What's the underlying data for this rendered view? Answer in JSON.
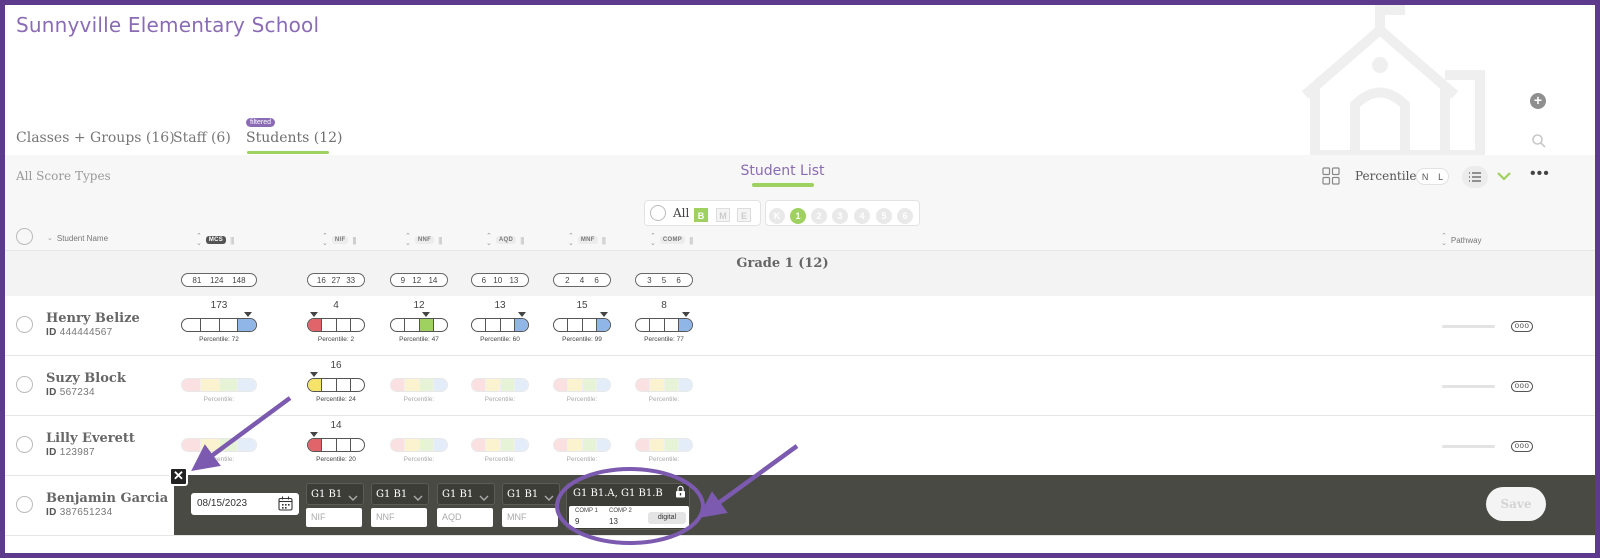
{
  "school": {
    "name": "Sunnyville Elementary School"
  },
  "tabs": [
    {
      "label": "Classes + Groups (16)"
    },
    {
      "label": "Staff (6)"
    },
    {
      "label": "Students (12)",
      "badge": "filtered",
      "active": true
    }
  ],
  "toolbar": {
    "score_types": "All Score Types",
    "list_title": "Student List",
    "percentile_label": "Percentile",
    "toggle_n": "N",
    "toggle_l": "L",
    "more": "•••"
  },
  "filters": {
    "all_label": "All",
    "terms": [
      "B",
      "M",
      "E"
    ],
    "active_term": "B",
    "grades": [
      "K",
      "1",
      "2",
      "3",
      "4",
      "5",
      "6"
    ],
    "active_grade": "1"
  },
  "columns": {
    "student_name": "Student Name",
    "measures": [
      "MCS",
      "NIF",
      "NNF",
      "AQD",
      "MNF",
      "COMP"
    ],
    "pathway": "Pathway"
  },
  "grade_group": {
    "title": "Grade 1 (12)",
    "ranges": [
      [
        "81",
        "124",
        "148"
      ],
      [
        "16",
        "27",
        "33"
      ],
      [
        "9",
        "12",
        "14"
      ],
      [
        "6",
        "10",
        "13"
      ],
      [
        "2",
        "4",
        "6"
      ],
      [
        "3",
        "5",
        "6"
      ]
    ]
  },
  "students": [
    {
      "name": "Henry Belize",
      "id_label": "ID",
      "id": "444444567",
      "scores": [
        {
          "value": "173",
          "percentile": "Percentile: 72",
          "fill_segment": 4,
          "color": "#8fb6e6",
          "level": 0.72
        },
        {
          "value": "4",
          "percentile": "Percentile: 2",
          "fill_segment": 1,
          "color": "#e0646a",
          "level": 0.02
        },
        {
          "value": "12",
          "percentile": "Percentile: 47",
          "fill_segment": 3,
          "color": "#9fd160",
          "level": 0.47
        },
        {
          "value": "13",
          "percentile": "Percentile: 60",
          "fill_segment": 4,
          "color": "#8fb6e6",
          "level": 0.6
        },
        {
          "value": "15",
          "percentile": "Percentile: 99",
          "fill_segment": 4,
          "color": "#8fb6e6",
          "level": 0.99
        },
        {
          "value": "8",
          "percentile": "Percentile: 77",
          "fill_segment": 4,
          "color": "#8fb6e6",
          "level": 0.77
        }
      ]
    },
    {
      "name": "Suzy Block",
      "id_label": "ID",
      "id": "567234",
      "scores": [
        {
          "value": "",
          "percentile": "Percentile:",
          "faded": true
        },
        {
          "value": "16",
          "percentile": "Percentile: 24",
          "fill_segment": 1,
          "color": "#f5e36a",
          "level": 0.24
        },
        {
          "value": "",
          "percentile": "Percentile:",
          "faded": true
        },
        {
          "value": "",
          "percentile": "Percentile:",
          "faded": true
        },
        {
          "value": "",
          "percentile": "Percentile:",
          "faded": true
        },
        {
          "value": "",
          "percentile": "Percentile:",
          "faded": true
        }
      ]
    },
    {
      "name": "Lilly Everett",
      "id_label": "ID",
      "id": "123987",
      "scores": [
        {
          "value": "",
          "percentile": "Percentile:",
          "faded": true
        },
        {
          "value": "14",
          "percentile": "Percentile: 20",
          "fill_segment": 1,
          "color": "#e0646a",
          "level": 0.2
        },
        {
          "value": "",
          "percentile": "Percentile:",
          "faded": true
        },
        {
          "value": "",
          "percentile": "Percentile:",
          "faded": true
        },
        {
          "value": "",
          "percentile": "Percentile:",
          "faded": true
        },
        {
          "value": "",
          "percentile": "Percentile:",
          "faded": true
        }
      ]
    },
    {
      "name": "Benjamin Garcia",
      "id_label": "ID",
      "id": "387651234"
    }
  ],
  "edit_panel": {
    "close": "✕",
    "date": "08/15/2023",
    "selects": [
      "G1 B1",
      "G1 B1",
      "G1 B1",
      "G1 B1"
    ],
    "placeholders": [
      "NIF",
      "NNF",
      "AQD",
      "MNF"
    ],
    "comp_title": "G1 B1.A, G1 B1.B",
    "comp1_label": "COMP 1",
    "comp2_label": "COMP 2",
    "comp1_value": "9",
    "comp2_value": "13",
    "mode": "digital",
    "save": "Save"
  },
  "colors": {
    "brand_purple": "#8a6bb4",
    "accent_green": "#9fd160",
    "frame_border": "#5d3a8c",
    "panel_dark": "#4a4a44",
    "low_red": "#e0646a",
    "mid_yellow": "#f5e36a",
    "high_blue": "#8fb6e6"
  }
}
